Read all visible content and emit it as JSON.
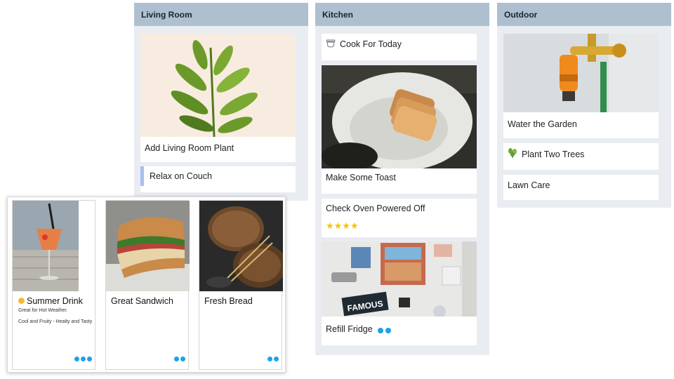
{
  "columns": {
    "living": {
      "title": "Living Room",
      "cards": {
        "plant": {
          "title": "Add Living Room Plant"
        },
        "couch": {
          "title": "Relax on Couch"
        }
      }
    },
    "kitchen": {
      "title": "Kitchen",
      "cards": {
        "cook": {
          "title": "Cook For Today",
          "icon": "cooking-pot-icon"
        },
        "toast": {
          "title": "Make Some Toast"
        },
        "oven": {
          "title": "Check Oven Powered Off",
          "rating": 4,
          "rating_text": "★★★★"
        },
        "fridge": {
          "title": "Refill Fridge",
          "dots": 2,
          "magnet_text": "FAMOUS"
        }
      }
    },
    "outdoor": {
      "title": "Outdoor",
      "cards": {
        "water": {
          "title": "Water the Garden"
        },
        "trees": {
          "title": "Plant Two Trees",
          "icon": "sprout-icon"
        },
        "lawn": {
          "title": "Lawn Care"
        }
      }
    }
  },
  "popup": {
    "cards": [
      {
        "title": "Summer Drink",
        "icon": "sun-icon",
        "desc1": "Great for Hot Weather.",
        "desc2": "Cool and Fruity - Healty and Tasty",
        "dots": 3
      },
      {
        "title": "Great Sandwich",
        "dots": 2
      },
      {
        "title": "Fresh Bread",
        "dots": 2
      }
    ]
  },
  "colors": {
    "column_bg": "#e9edf2",
    "header_bg": "#aec0cf",
    "accent_blue": "#a6c0ee",
    "dot_blue": "#1aa3e8",
    "star_yellow": "#f5c400"
  }
}
